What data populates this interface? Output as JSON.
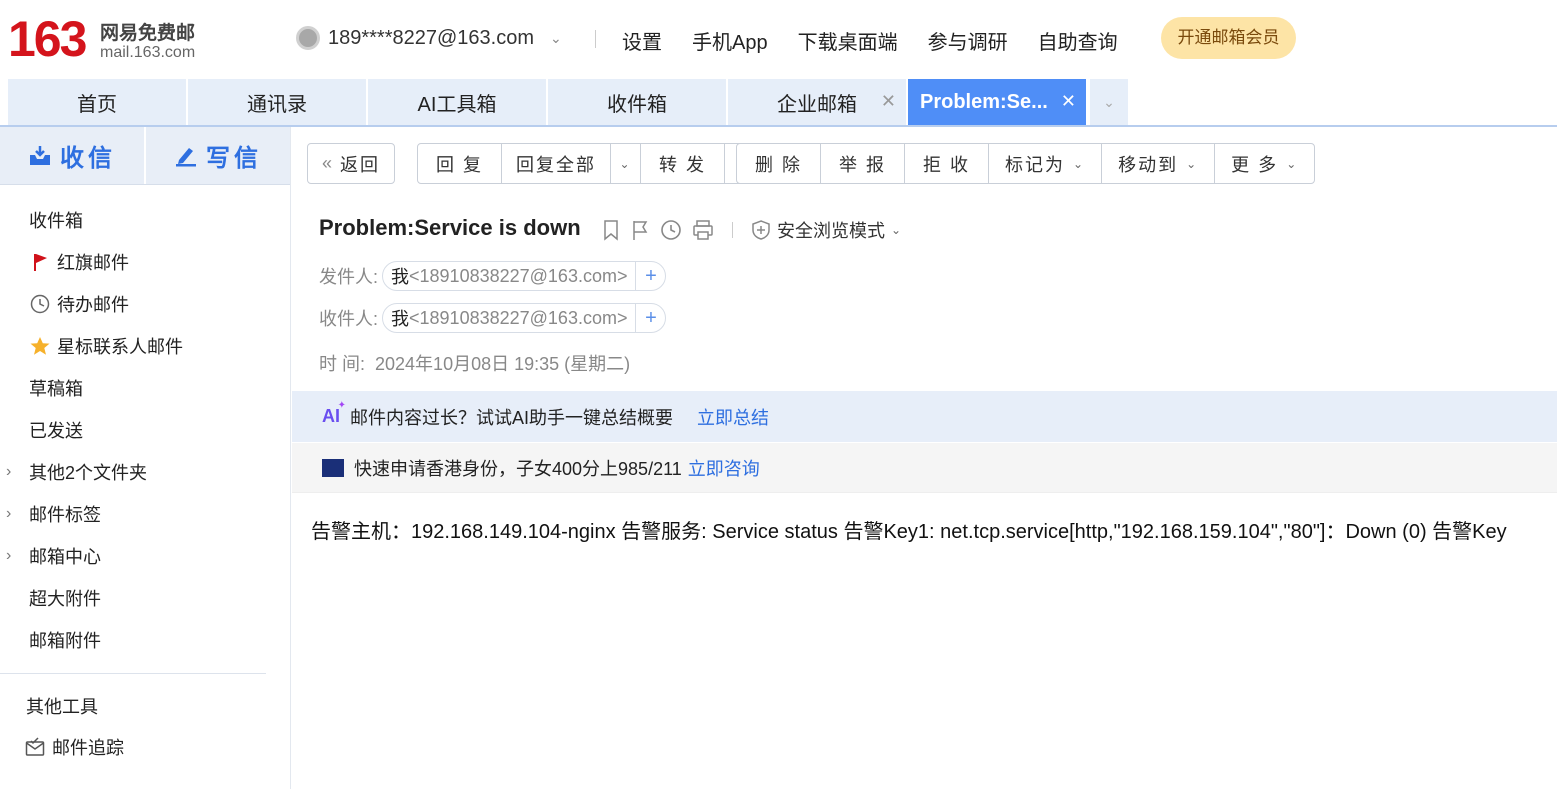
{
  "header": {
    "logo_number": "163",
    "logo_cn": "网易免费邮",
    "logo_en": "mail.163.com",
    "account": "189****8227@163.com",
    "nav": [
      "设置",
      "手机App",
      "下载桌面端",
      "参与调研",
      "自助查询"
    ],
    "vip_button": "开通邮箱会员"
  },
  "tabs": [
    {
      "label": "首页"
    },
    {
      "label": "通讯录"
    },
    {
      "label": "AI工具箱"
    },
    {
      "label": "收件箱"
    },
    {
      "label": "企业邮箱"
    },
    {
      "label": "Problem:Se..."
    }
  ],
  "sidebar": {
    "receive": "收信",
    "compose": "写信",
    "items": [
      {
        "label": "收件箱"
      },
      {
        "label": "红旗邮件",
        "icon": "flag-icon"
      },
      {
        "label": "待办邮件",
        "icon": "clock-icon"
      },
      {
        "label": "星标联系人邮件",
        "icon": "star-icon"
      },
      {
        "label": "草稿箱"
      },
      {
        "label": "已发送"
      },
      {
        "label": "其他2个文件夹"
      },
      {
        "label": "邮件标签"
      },
      {
        "label": "邮箱中心"
      },
      {
        "label": "超大附件"
      },
      {
        "label": "邮箱附件"
      }
    ],
    "tools_title": "其他工具",
    "tools": [
      {
        "label": "邮件追踪",
        "icon": "mail-track-icon"
      }
    ]
  },
  "toolbar": {
    "back": "返回",
    "reply": "回 复",
    "reply_all": "回复全部",
    "forward": "转 发",
    "delete": "删 除",
    "report": "举 报",
    "reject": "拒 收",
    "mark_as": "标记为",
    "move_to": "移动到",
    "more": "更 多"
  },
  "mail": {
    "subject": "Problem:Service is down",
    "safe_mode": "安全浏览模式",
    "from_label": "发件人:",
    "to_label": "收件人:",
    "time_label": "时 间:",
    "sender_name": "我",
    "sender_email": "<18910838227@163.com>",
    "recipient_name": "我",
    "recipient_email": "<18910838227@163.com>",
    "time": "2024年10月08日 19:35 (星期二)",
    "ai_prompt": "邮件内容过长？试试AI助手一键总结概要",
    "ai_link": "立即总结",
    "ad_text": "快速申请香港身份，子女400分上985/211",
    "ad_link": "立即咨询",
    "body": "告警主机：192.168.149.104-nginx 告警服务: Service status 告警Key1: net.tcp.service[http,\"192.168.159.104\",\"80\"]：Down (0) 告警Key"
  },
  "colors": {
    "accent": "#2e6fe0",
    "active_tab": "#4f8ef7",
    "logo_red": "#d4141c",
    "vip_bg": "#fde4a6"
  }
}
